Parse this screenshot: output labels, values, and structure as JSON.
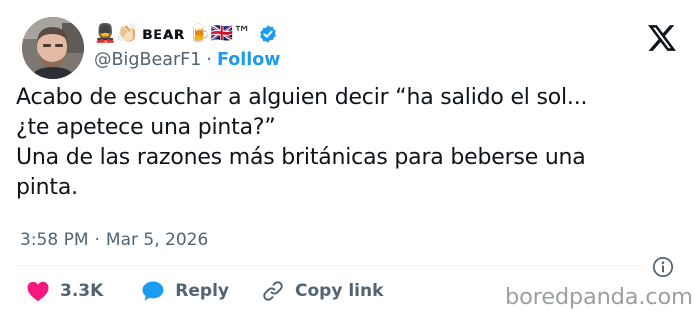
{
  "author": {
    "display_name_emoji_start": "💂👏🏻",
    "display_name_text": "ʙᴇᴀʀ",
    "display_name_emoji_end": "🍺🇬🇧™",
    "handle": "@BigBearF1",
    "separator": "·",
    "follow_label": "Follow",
    "verified": true
  },
  "tweet": {
    "text": "Acabo de escuchar a alguien decir “ha salido el sol...\n¿te apetece una pinta?”\nUna de las razones más británicas para beberse una\npinta.",
    "time": "3:58 PM",
    "separator": "·",
    "date": "Mar 5, 2026"
  },
  "actions": {
    "likes": "3.3K",
    "reply_label": "Reply",
    "copy_link_label": "Copy link"
  },
  "watermark": "boredpanda.com",
  "colors": {
    "accent": "#1d9bf0",
    "like": "#f91880",
    "reply": "#1d9bf0",
    "text": "#0f1419",
    "secondary": "#536471",
    "watermark": "#9aa0a4"
  },
  "icons": {
    "brand": "x-logo-icon",
    "verified": "verified-badge-icon",
    "like": "heart-icon",
    "reply": "speech-bubble-icon",
    "copy": "link-icon",
    "info": "info-icon"
  }
}
